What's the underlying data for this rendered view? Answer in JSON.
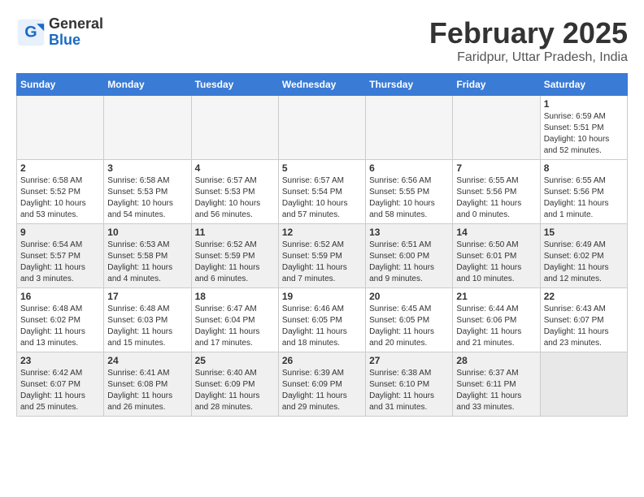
{
  "logo": {
    "general": "General",
    "blue": "Blue"
  },
  "title": {
    "month": "February 2025",
    "location": "Faridpur, Uttar Pradesh, India"
  },
  "headers": [
    "Sunday",
    "Monday",
    "Tuesday",
    "Wednesday",
    "Thursday",
    "Friday",
    "Saturday"
  ],
  "weeks": [
    {
      "shade": false,
      "days": [
        {
          "num": "",
          "info": ""
        },
        {
          "num": "",
          "info": ""
        },
        {
          "num": "",
          "info": ""
        },
        {
          "num": "",
          "info": ""
        },
        {
          "num": "",
          "info": ""
        },
        {
          "num": "",
          "info": ""
        },
        {
          "num": "1",
          "info": "Sunrise: 6:59 AM\nSunset: 5:51 PM\nDaylight: 10 hours\nand 52 minutes."
        }
      ]
    },
    {
      "shade": false,
      "days": [
        {
          "num": "2",
          "info": "Sunrise: 6:58 AM\nSunset: 5:52 PM\nDaylight: 10 hours\nand 53 minutes."
        },
        {
          "num": "3",
          "info": "Sunrise: 6:58 AM\nSunset: 5:53 PM\nDaylight: 10 hours\nand 54 minutes."
        },
        {
          "num": "4",
          "info": "Sunrise: 6:57 AM\nSunset: 5:53 PM\nDaylight: 10 hours\nand 56 minutes."
        },
        {
          "num": "5",
          "info": "Sunrise: 6:57 AM\nSunset: 5:54 PM\nDaylight: 10 hours\nand 57 minutes."
        },
        {
          "num": "6",
          "info": "Sunrise: 6:56 AM\nSunset: 5:55 PM\nDaylight: 10 hours\nand 58 minutes."
        },
        {
          "num": "7",
          "info": "Sunrise: 6:55 AM\nSunset: 5:56 PM\nDaylight: 11 hours\nand 0 minutes."
        },
        {
          "num": "8",
          "info": "Sunrise: 6:55 AM\nSunset: 5:56 PM\nDaylight: 11 hours\nand 1 minute."
        }
      ]
    },
    {
      "shade": true,
      "days": [
        {
          "num": "9",
          "info": "Sunrise: 6:54 AM\nSunset: 5:57 PM\nDaylight: 11 hours\nand 3 minutes."
        },
        {
          "num": "10",
          "info": "Sunrise: 6:53 AM\nSunset: 5:58 PM\nDaylight: 11 hours\nand 4 minutes."
        },
        {
          "num": "11",
          "info": "Sunrise: 6:52 AM\nSunset: 5:59 PM\nDaylight: 11 hours\nand 6 minutes."
        },
        {
          "num": "12",
          "info": "Sunrise: 6:52 AM\nSunset: 5:59 PM\nDaylight: 11 hours\nand 7 minutes."
        },
        {
          "num": "13",
          "info": "Sunrise: 6:51 AM\nSunset: 6:00 PM\nDaylight: 11 hours\nand 9 minutes."
        },
        {
          "num": "14",
          "info": "Sunrise: 6:50 AM\nSunset: 6:01 PM\nDaylight: 11 hours\nand 10 minutes."
        },
        {
          "num": "15",
          "info": "Sunrise: 6:49 AM\nSunset: 6:02 PM\nDaylight: 11 hours\nand 12 minutes."
        }
      ]
    },
    {
      "shade": false,
      "days": [
        {
          "num": "16",
          "info": "Sunrise: 6:48 AM\nSunset: 6:02 PM\nDaylight: 11 hours\nand 13 minutes."
        },
        {
          "num": "17",
          "info": "Sunrise: 6:48 AM\nSunset: 6:03 PM\nDaylight: 11 hours\nand 15 minutes."
        },
        {
          "num": "18",
          "info": "Sunrise: 6:47 AM\nSunset: 6:04 PM\nDaylight: 11 hours\nand 17 minutes."
        },
        {
          "num": "19",
          "info": "Sunrise: 6:46 AM\nSunset: 6:05 PM\nDaylight: 11 hours\nand 18 minutes."
        },
        {
          "num": "20",
          "info": "Sunrise: 6:45 AM\nSunset: 6:05 PM\nDaylight: 11 hours\nand 20 minutes."
        },
        {
          "num": "21",
          "info": "Sunrise: 6:44 AM\nSunset: 6:06 PM\nDaylight: 11 hours\nand 21 minutes."
        },
        {
          "num": "22",
          "info": "Sunrise: 6:43 AM\nSunset: 6:07 PM\nDaylight: 11 hours\nand 23 minutes."
        }
      ]
    },
    {
      "shade": true,
      "days": [
        {
          "num": "23",
          "info": "Sunrise: 6:42 AM\nSunset: 6:07 PM\nDaylight: 11 hours\nand 25 minutes."
        },
        {
          "num": "24",
          "info": "Sunrise: 6:41 AM\nSunset: 6:08 PM\nDaylight: 11 hours\nand 26 minutes."
        },
        {
          "num": "25",
          "info": "Sunrise: 6:40 AM\nSunset: 6:09 PM\nDaylight: 11 hours\nand 28 minutes."
        },
        {
          "num": "26",
          "info": "Sunrise: 6:39 AM\nSunset: 6:09 PM\nDaylight: 11 hours\nand 29 minutes."
        },
        {
          "num": "27",
          "info": "Sunrise: 6:38 AM\nSunset: 6:10 PM\nDaylight: 11 hours\nand 31 minutes."
        },
        {
          "num": "28",
          "info": "Sunrise: 6:37 AM\nSunset: 6:11 PM\nDaylight: 11 hours\nand 33 minutes."
        },
        {
          "num": "",
          "info": ""
        }
      ]
    }
  ]
}
